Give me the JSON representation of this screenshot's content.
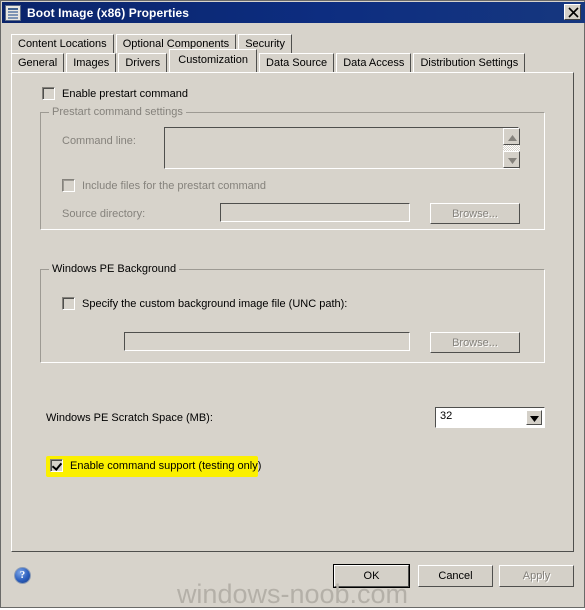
{
  "window": {
    "title": "Boot Image (x86) Properties",
    "icon": "properties-document-icon",
    "close_label": "✕"
  },
  "tabs": {
    "top_row": [
      {
        "label": "Content Locations",
        "selected": false
      },
      {
        "label": "Optional Components",
        "selected": false
      },
      {
        "label": "Security",
        "selected": false
      }
    ],
    "bottom_row": [
      {
        "label": "General",
        "selected": false
      },
      {
        "label": "Images",
        "selected": false
      },
      {
        "label": "Drivers",
        "selected": false
      },
      {
        "label": "Customization",
        "selected": true
      },
      {
        "label": "Data Source",
        "selected": false
      },
      {
        "label": "Data Access",
        "selected": false
      },
      {
        "label": "Distribution Settings",
        "selected": false
      }
    ]
  },
  "customization": {
    "enable_prestart": {
      "label": "Enable prestart command",
      "checked": false,
      "enabled": true
    },
    "prestart_group": {
      "label": "Prestart command settings",
      "enabled": false,
      "command_line_label": "Command line:",
      "command_line_value": "",
      "include_files": {
        "label": "Include files for the prestart command",
        "checked": false
      },
      "source_directory_label": "Source directory:",
      "source_directory_value": "",
      "browse_label": "Browse..."
    },
    "winpe_background_group": {
      "label": "Windows PE Background",
      "specify_custom": {
        "label": "Specify the custom background image file (UNC path):",
        "checked": false
      },
      "path_value": "",
      "browse_label": "Browse..."
    },
    "scratch_space": {
      "label": "Windows PE Scratch Space (MB):",
      "value": "32"
    },
    "command_support": {
      "label": "Enable command support (testing only)",
      "checked": true,
      "highlighted": true,
      "highlight_color": "#fbf000"
    }
  },
  "footer": {
    "help_icon": "help-question-icon",
    "buttons": [
      {
        "label": "OK",
        "enabled": true,
        "default": true
      },
      {
        "label": "Cancel",
        "enabled": true,
        "default": false
      },
      {
        "label": "Apply",
        "enabled": false,
        "default": false
      }
    ]
  },
  "watermark": {
    "text": "windows-noob.com"
  }
}
